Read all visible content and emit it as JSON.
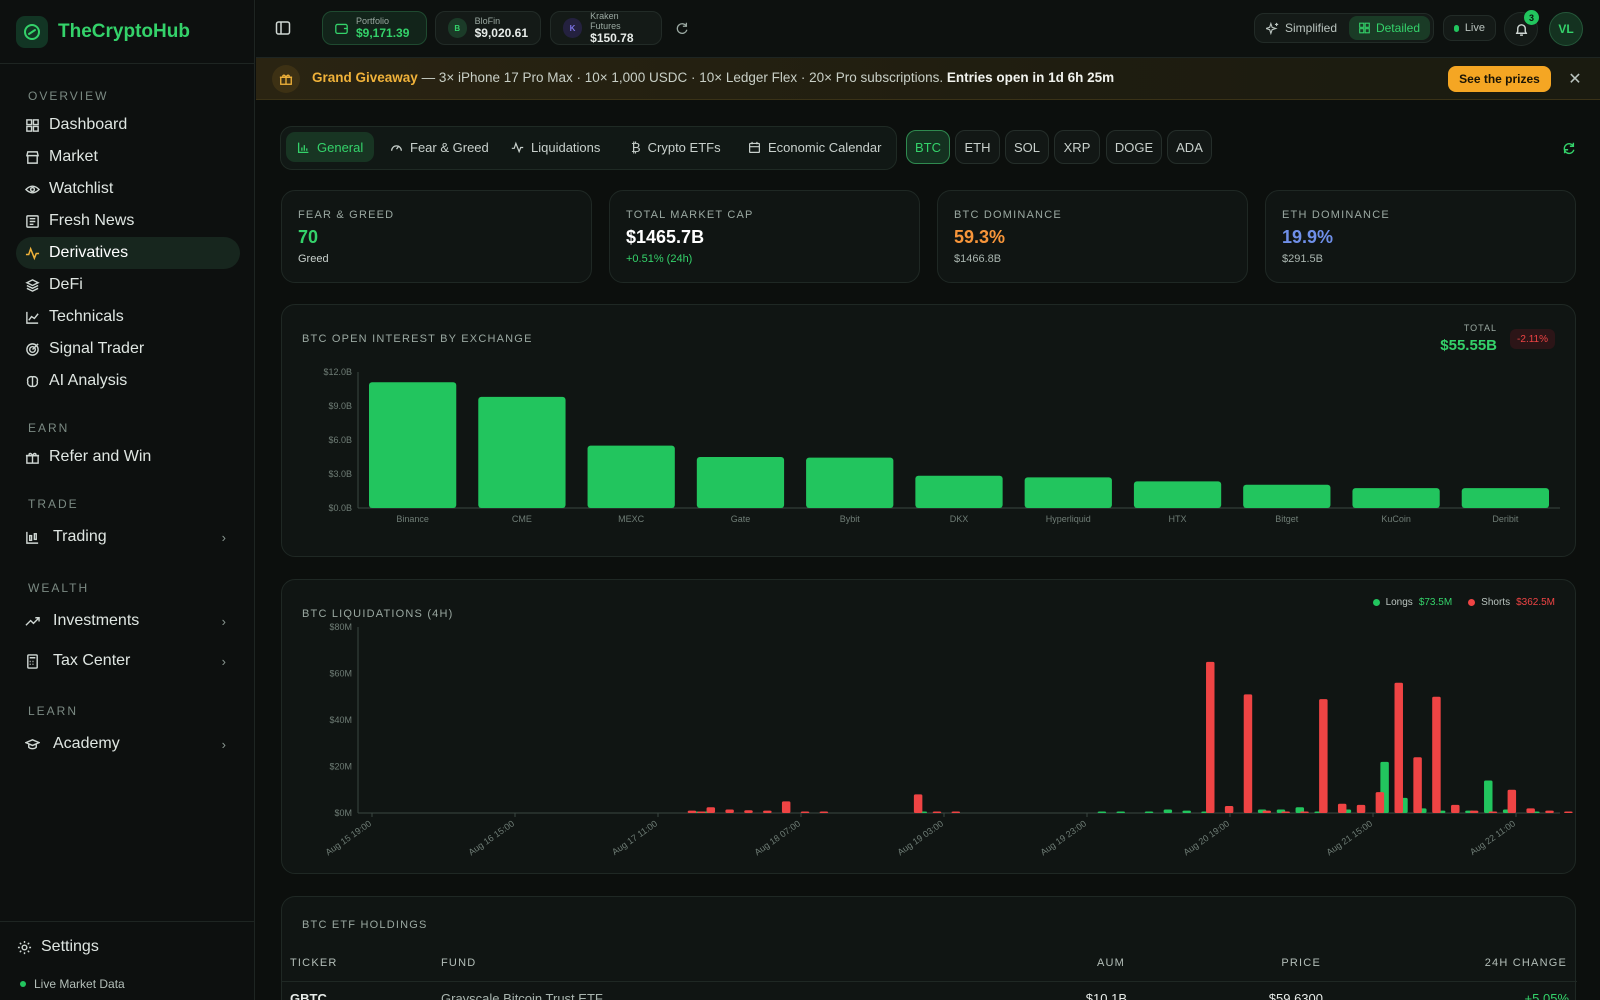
{
  "app": {
    "name": "TheCryptoHub"
  },
  "sidebar": {
    "sections": [
      {
        "label": "OVERVIEW",
        "items": [
          {
            "label": "Dashboard",
            "icon": "grid-icon"
          },
          {
            "label": "Market",
            "icon": "store-icon"
          },
          {
            "label": "Watchlist",
            "icon": "eye-icon"
          },
          {
            "label": "Fresh News",
            "icon": "newspaper-icon"
          },
          {
            "label": "Derivatives",
            "icon": "activity-icon",
            "active": true
          },
          {
            "label": "DeFi",
            "icon": "layers-icon"
          },
          {
            "label": "Technicals",
            "icon": "line-chart-icon"
          },
          {
            "label": "Signal Trader",
            "icon": "target-icon"
          },
          {
            "label": "AI Analysis",
            "icon": "brain-icon"
          }
        ]
      },
      {
        "label": "EARN",
        "items": [
          {
            "label": "Refer and Win",
            "icon": "gift-icon"
          }
        ]
      },
      {
        "label": "TRADE",
        "items": [
          {
            "label": "Trading",
            "icon": "candles-icon",
            "expandable": true
          }
        ]
      },
      {
        "label": "WEALTH",
        "items": [
          {
            "label": "Investments",
            "icon": "trending-up-icon",
            "expandable": true
          },
          {
            "label": "Tax Center",
            "icon": "calculator-icon",
            "expandable": true
          }
        ]
      },
      {
        "label": "LEARN",
        "items": [
          {
            "label": "Academy",
            "icon": "graduation-cap-icon",
            "expandable": true
          }
        ]
      }
    ],
    "settings_label": "Settings",
    "live_data_label": "Live Market Data"
  },
  "topbar": {
    "accounts": [
      {
        "label": "Portfolio",
        "value": "$9,171.39"
      },
      {
        "label": "BloFin",
        "value": "$9,020.61",
        "badge": "B"
      },
      {
        "label": "Kraken Futures",
        "value": "$150.78",
        "badge": "K"
      }
    ],
    "view_modes": [
      "Simplified",
      "Detailed"
    ],
    "active_view": "Detailed",
    "live_label": "Live",
    "notification_count": "3",
    "avatar_initials": "VL"
  },
  "banner": {
    "title": "Grand Giveaway",
    "text": " — 3× iPhone 17 Pro Max · 10× 1,000 USDC · 10× Ledger Flex · 20× Pro subscriptions.",
    "countdown": "Entries open in 1d 6h 25m",
    "cta": "See the prizes"
  },
  "tabs": [
    {
      "label": "General",
      "icon": "bar-chart-icon",
      "active": true
    },
    {
      "label": "Fear & Greed",
      "icon": "gauge-icon"
    },
    {
      "label": "Liquidations",
      "icon": "activity-icon"
    },
    {
      "label": "Crypto ETFs",
      "icon": "bitcoin-icon"
    },
    {
      "label": "Economic Calendar",
      "icon": "calendar-icon"
    }
  ],
  "assets": [
    "BTC",
    "ETH",
    "SOL",
    "XRP",
    "DOGE",
    "ADA"
  ],
  "active_asset": "BTC",
  "stats": [
    {
      "label": "FEAR & GREED",
      "value": "70",
      "sub": "Greed",
      "color": "#34d26a",
      "sub_color": "#c8d0cc"
    },
    {
      "label": "TOTAL MARKET CAP",
      "value": "$1465.7B",
      "sub": "+0.51% (24h)",
      "color": "#ffffff",
      "sub_color": "#34d26a"
    },
    {
      "label": "BTC DOMINANCE",
      "value": "59.3%",
      "sub": "$1466.8B",
      "color": "#f7953a",
      "sub_color": "#a9b5af"
    },
    {
      "label": "ETH DOMINANCE",
      "value": "19.9%",
      "sub": "$291.5B",
      "color": "#6f8fe8",
      "sub_color": "#a9b5af"
    }
  ],
  "chart_data": [
    {
      "type": "bar",
      "title": "BTC OPEN INTEREST BY EXCHANGE",
      "total_label": "TOTAL",
      "total_value": "$55.55B",
      "change": "-2.11%",
      "categories": [
        "Binance",
        "CME",
        "MEXC",
        "Gate",
        "Bybit",
        "DKX",
        "Hyperliquid",
        "HTX",
        "Bitget",
        "KuCoin",
        "Deribit"
      ],
      "values": [
        11.1,
        9.8,
        5.5,
        4.5,
        4.45,
        2.85,
        2.7,
        2.35,
        2.05,
        1.75,
        1.75
      ],
      "yticks": [
        "$0.0B",
        "$3.0B",
        "$6.0B",
        "$9.0B",
        "$12.0B"
      ],
      "ylim": [
        0,
        12
      ],
      "color": "#22c55e"
    },
    {
      "type": "bar",
      "title": "BTC LIQUIDATIONS (4H)",
      "legend": [
        {
          "name": "Longs",
          "total": "$73.5M",
          "color": "#22c55e"
        },
        {
          "name": "Shorts",
          "total": "$362.5M",
          "color": "#ef4444"
        }
      ],
      "legend_position": "top-right",
      "yticks": [
        "$0M",
        "$20M",
        "$40M",
        "$60M",
        "$80M"
      ],
      "ylim": [
        0,
        80
      ],
      "xticks": [
        "Aug 15 19:00",
        "Aug 16 15:00",
        "Aug 17 11:00",
        "Aug 18 07:00",
        "Aug 19 03:00",
        "Aug 19 23:00",
        "Aug 20 19:00",
        "Aug 21 15:00",
        "Aug 22 11:00"
      ],
      "series": [
        {
          "name": "Longs",
          "color": "#22c55e",
          "values": [
            0,
            0,
            0,
            0,
            0,
            0,
            0,
            0,
            0,
            0,
            0,
            0,
            0,
            0,
            0,
            0,
            0,
            0,
            0,
            0,
            0,
            0,
            0,
            0,
            0,
            0,
            0,
            0,
            0,
            0,
            0,
            0,
            0,
            0,
            0.5,
            0.2,
            0,
            0,
            0,
            0,
            0,
            0,
            0,
            0,
            0,
            0,
            0,
            0,
            0,
            0,
            0,
            0,
            0,
            0,
            0,
            0,
            0,
            0,
            0.2,
            0,
            0,
            0,
            0,
            0,
            0,
            0,
            0,
            0,
            0,
            0,
            0,
            0,
            0,
            0,
            0,
            0,
            0,
            0.2,
            0,
            0.2,
            0,
            0,
            0.2,
            0,
            1.5,
            0,
            1,
            0,
            0.2,
            0,
            0,
            0,
            0,
            0,
            1.5,
            0,
            1.5,
            0,
            2.5,
            0,
            0.2,
            0,
            0,
            1.5,
            0,
            0,
            0,
            22,
            0,
            6.5,
            0,
            2,
            0,
            1,
            0,
            0,
            1,
            0,
            14,
            0,
            1.5,
            0,
            0,
            0.5,
            0
          ]
        },
        {
          "name": "Shorts",
          "color": "#ef4444",
          "values": [
            0,
            0,
            0,
            0,
            0,
            0,
            0,
            0,
            0,
            0,
            0,
            0,
            0,
            0,
            0,
            0,
            0,
            0,
            0,
            0,
            0,
            0,
            0,
            0,
            0,
            0,
            0,
            0,
            0,
            0,
            0,
            0,
            0,
            1,
            0.3,
            2.5,
            0,
            1.5,
            0,
            1.2,
            0,
            1,
            0,
            5,
            0,
            0.5,
            0,
            0.2,
            0,
            0,
            0,
            0,
            0,
            0,
            0,
            0,
            0,
            8,
            0,
            0.3,
            0,
            0.2,
            0,
            0,
            0,
            0,
            0,
            0,
            0,
            0,
            0,
            0,
            0,
            0,
            0,
            0,
            0,
            0,
            0,
            0,
            0,
            0,
            0,
            0,
            0,
            0,
            0,
            0,
            65,
            0,
            3,
            0,
            51,
            0,
            1,
            0,
            0.5,
            0,
            0.5,
            0,
            49,
            0,
            4,
            0,
            3.5,
            0,
            9,
            0,
            56,
            0,
            24,
            0,
            50,
            0,
            3.5,
            0,
            1,
            0,
            0.5,
            0,
            10,
            0,
            2,
            0,
            1,
            0,
            0.5,
            0,
            0.2
          ]
        }
      ]
    }
  ],
  "etf": {
    "title": "BTC ETF HOLDINGS",
    "columns": [
      "TICKER",
      "FUND",
      "AUM",
      "PRICE",
      "24H CHANGE"
    ],
    "rows": [
      {
        "ticker": "GBTC",
        "fund": "Grayscale Bitcoin Trust ETF",
        "aum": "$10.1B",
        "price": "$59.6300",
        "change": "+5.05%"
      }
    ]
  }
}
